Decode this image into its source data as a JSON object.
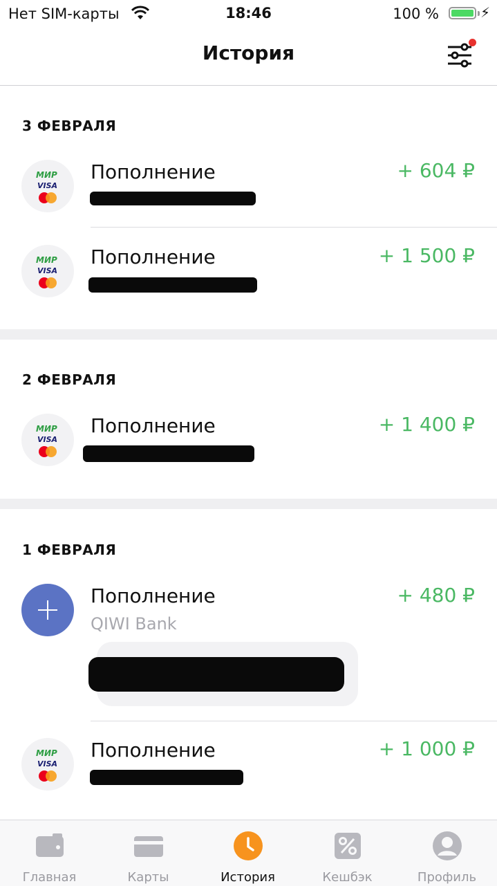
{
  "status": {
    "carrier": "Нет SIM-карты",
    "time": "18:46",
    "battery": "100 %"
  },
  "header": {
    "title": "История"
  },
  "sections": [
    {
      "date": "3 ФЕВРАЛЯ",
      "items": [
        {
          "title": "Пополнение",
          "amount": "+ 604 ₽"
        },
        {
          "title": "Пополнение",
          "amount": "+ 1 500 ₽"
        }
      ]
    },
    {
      "date": "2 ФЕВРАЛЯ",
      "items": [
        {
          "title": "Пополнение",
          "amount": "+ 1 400 ₽"
        }
      ]
    },
    {
      "date": "1 ФЕВРАЛЯ",
      "items": [
        {
          "title": "Пополнение",
          "subtitle": "QIWI Bank",
          "amount": "+ 480 ₽"
        },
        {
          "title": "Пополнение",
          "amount": "+ 1 000 ₽"
        }
      ]
    }
  ],
  "card_logo": {
    "mir": "МИР",
    "visa": "VISA"
  },
  "tabs": [
    {
      "label": "Главная",
      "icon": "wallet-icon"
    },
    {
      "label": "Карты",
      "icon": "card-icon"
    },
    {
      "label": "История",
      "icon": "clock-icon",
      "active": true
    },
    {
      "label": "Кешбэк",
      "icon": "percent-icon"
    },
    {
      "label": "Профиль",
      "icon": "profile-icon"
    }
  ],
  "colors": {
    "accent": "#f7931e",
    "income": "#4ab863",
    "add_icon": "#5b73c4",
    "badge": "#e8322e"
  }
}
